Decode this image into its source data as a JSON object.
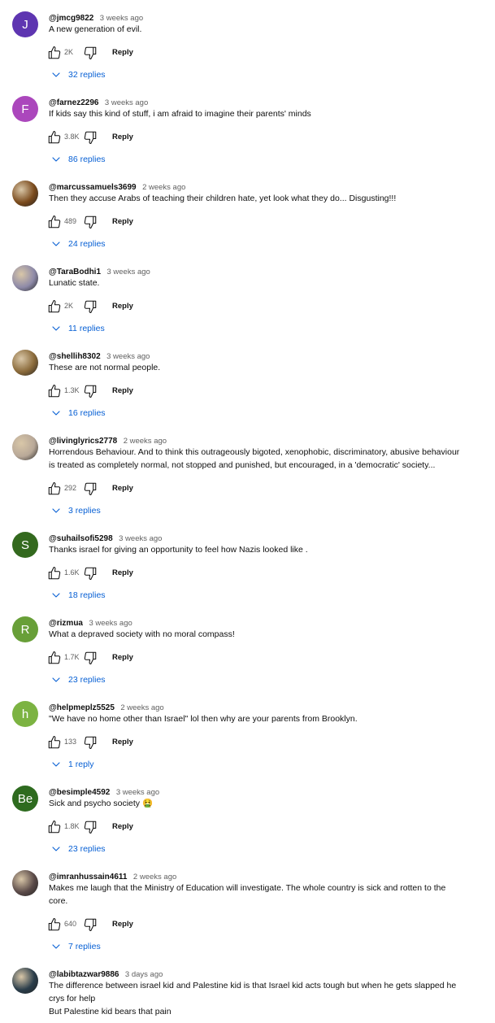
{
  "icons": {
    "like": "thumb-up-icon",
    "dislike": "thumb-down-icon",
    "expand": "chevron-down-icon"
  },
  "colors": {
    "reply_link": "#065fd4",
    "meta_gray": "#606060"
  },
  "comments": [
    {
      "author": "@jmcg9822",
      "time": "3 weeks ago",
      "text_lines": [
        "A new generation of evil."
      ],
      "likes": "2K",
      "reply_label": "Reply",
      "replies_label": "32 replies",
      "avatar_letter": "J",
      "avatar_color": "#5e35b1"
    },
    {
      "author": "@farnez2296",
      "time": "3 weeks ago",
      "text_lines": [
        "If kids say this kind of stuff, i am afraid to imagine their parents' minds"
      ],
      "likes": "3.8K",
      "reply_label": "Reply",
      "replies_label": "86 replies",
      "avatar_letter": "F",
      "avatar_color": "#ab47bc"
    },
    {
      "author": "@marcussamuels3699",
      "time": "2 weeks ago",
      "text_lines": [
        "Then they accuse Arabs of teaching their children hate, yet look what they do... Disgusting!!!"
      ],
      "likes": "489",
      "reply_label": "Reply",
      "replies_label": "24 replies",
      "avatar_letter": "",
      "avatar_color": "#7a4a1c",
      "avatar_photo": true
    },
    {
      "author": "@TaraBodhi1",
      "time": "3 weeks ago",
      "text_lines": [
        "Lunatic state."
      ],
      "likes": "2K",
      "reply_label": "Reply",
      "replies_label": "11 replies",
      "avatar_letter": "",
      "avatar_color": "#8e8aa8",
      "avatar_photo": true
    },
    {
      "author": "@shellih8302",
      "time": "3 weeks ago",
      "text_lines": [
        "These are not normal people."
      ],
      "likes": "1.3K",
      "reply_label": "Reply",
      "replies_label": "16 replies",
      "avatar_letter": "",
      "avatar_color": "#8a6a3a",
      "avatar_photo": true
    },
    {
      "author": "@livinglyrics2778",
      "time": "2 weeks ago",
      "text_lines": [
        "Horrendous Behaviour. And to think this outrageously bigoted, xenophobic, discriminatory, abusive behaviour",
        "is treated as completely normal, not stopped and punished, but encouraged, in a 'democratic' society..."
      ],
      "likes": "292",
      "reply_label": "Reply",
      "replies_label": "3 replies",
      "avatar_letter": "",
      "avatar_color": "#b8a898",
      "avatar_photo": true
    },
    {
      "author": "@suhailsofi5298",
      "time": "3 weeks ago",
      "text_lines": [
        "Thanks israel for giving an opportunity to feel how Nazis looked like ."
      ],
      "likes": "1.6K",
      "reply_label": "Reply",
      "replies_label": "18 replies",
      "avatar_letter": "S",
      "avatar_color": "#33691e"
    },
    {
      "author": "@rizmua",
      "time": "3 weeks ago",
      "text_lines": [
        "What a depraved society with no moral compass!"
      ],
      "likes": "1.7K",
      "reply_label": "Reply",
      "replies_label": "23 replies",
      "avatar_letter": "R",
      "avatar_color": "#689f38"
    },
    {
      "author": "@helpmeplz5525",
      "time": "2 weeks ago",
      "text_lines": [
        "\"We have no home other than Israel\" lol then why are your parents from Brooklyn."
      ],
      "likes": "133",
      "reply_label": "Reply",
      "replies_label": "1 reply",
      "avatar_letter": "h",
      "avatar_color": "#7cb342"
    },
    {
      "author": "@besimple4592",
      "time": "3 weeks ago",
      "text_lines": [
        "Sick and psycho society 🤮"
      ],
      "likes": "1.8K",
      "reply_label": "Reply",
      "replies_label": "23 replies",
      "avatar_letter": "Be",
      "avatar_color": "#2e6b1f"
    },
    {
      "author": "@imranhussain4611",
      "time": "2 weeks ago",
      "text_lines": [
        "Makes me laugh that the Ministry of Education will investigate. The whole country is sick and rotten to the",
        "core."
      ],
      "likes": "640",
      "reply_label": "Reply",
      "replies_label": "7 replies",
      "avatar_letter": "",
      "avatar_color": "#5a4a48",
      "avatar_photo": true
    },
    {
      "author": "@labibtazwar9886",
      "time": "3 days ago",
      "text_lines": [
        "The difference between israel kid and Palestine kid  is that Israel kid acts tough but when he gets slapped he",
        "crys for help",
        "But Palestine kid bears that pain"
      ],
      "likes": "",
      "reply_label": "",
      "replies_label": "",
      "avatar_letter": "",
      "avatar_color": "#2a3d4a",
      "avatar_photo": true
    }
  ]
}
